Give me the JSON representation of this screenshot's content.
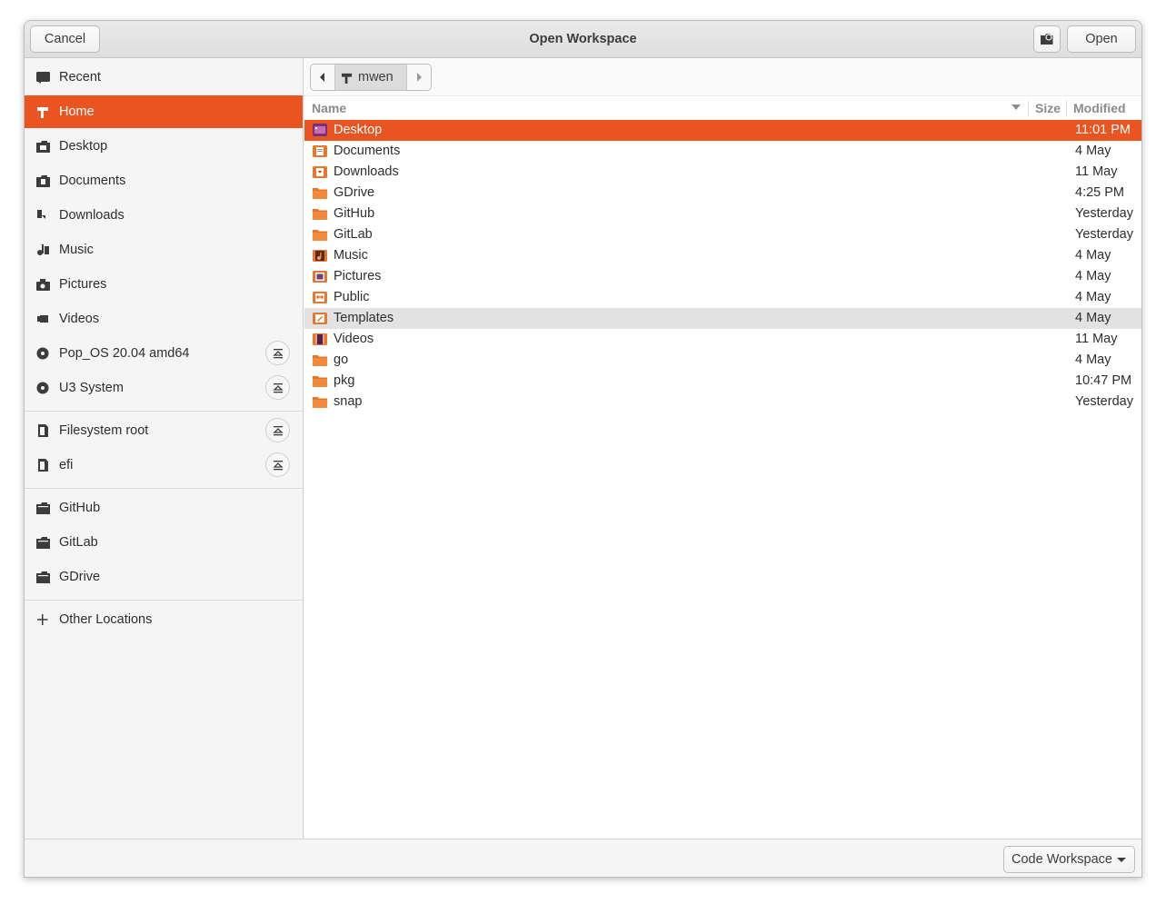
{
  "dialog": {
    "title": "Open Workspace",
    "cancel_label": "Cancel",
    "open_label": "Open",
    "new_folder_icon": "folder-new-icon"
  },
  "sidebar": {
    "items": [
      {
        "label": "Recent",
        "icon": "recent-icon"
      },
      {
        "label": "Home",
        "icon": "home-icon",
        "active": true
      },
      {
        "label": "Desktop",
        "icon": "desktop-folder-icon"
      },
      {
        "label": "Documents",
        "icon": "documents-folder-icon"
      },
      {
        "label": "Downloads",
        "icon": "downloads-folder-icon"
      },
      {
        "label": "Music",
        "icon": "music-folder-icon"
      },
      {
        "label": "Pictures",
        "icon": "pictures-folder-icon"
      },
      {
        "label": "Videos",
        "icon": "videos-folder-icon"
      },
      {
        "label": "Pop_OS 20.04 amd64",
        "icon": "optical-disc-icon",
        "eject": true
      },
      {
        "label": "U3 System",
        "icon": "optical-disc-icon",
        "eject": true
      },
      {
        "label": "Filesystem root",
        "icon": "drive-icon",
        "eject": true
      },
      {
        "label": "efi",
        "icon": "drive-icon",
        "eject": true
      },
      {
        "label": "GitHub",
        "icon": "bookmark-folder-icon"
      },
      {
        "label": "GitLab",
        "icon": "bookmark-folder-icon"
      },
      {
        "label": "GDrive",
        "icon": "bookmark-folder-icon"
      },
      {
        "label": "Other Locations",
        "icon": "plus-icon"
      }
    ]
  },
  "pathbar": {
    "current": "mwen",
    "back_icon": "chevron-left-icon",
    "forward_icon": "chevron-right-icon"
  },
  "filelist": {
    "columns": {
      "name": "Name",
      "size": "Size",
      "modified": "Modified"
    },
    "rows": [
      {
        "name": "Desktop",
        "modified": "11:01 PM",
        "selected": true,
        "icon": "desktop-folder-icon"
      },
      {
        "name": "Documents",
        "modified": "4 May",
        "icon": "documents-folder-icon"
      },
      {
        "name": "Downloads",
        "modified": "11 May",
        "icon": "downloads-folder-icon"
      },
      {
        "name": "GDrive",
        "modified": " 4:25 PM",
        "icon": "folder-icon"
      },
      {
        "name": "GitHub",
        "modified": "Yesterday",
        "icon": "folder-icon"
      },
      {
        "name": "GitLab",
        "modified": "Yesterday",
        "icon": "folder-icon"
      },
      {
        "name": "Music",
        "modified": "4 May",
        "icon": "music-folder-icon"
      },
      {
        "name": "Pictures",
        "modified": "4 May",
        "icon": "pictures-folder-icon"
      },
      {
        "name": "Public",
        "modified": "4 May",
        "icon": "public-folder-icon"
      },
      {
        "name": "Templates",
        "modified": "4 May",
        "hover": true,
        "icon": "templates-folder-icon"
      },
      {
        "name": "Videos",
        "modified": "11 May",
        "icon": "videos-folder-icon"
      },
      {
        "name": "go",
        "modified": "4 May",
        "icon": "folder-icon"
      },
      {
        "name": "pkg",
        "modified": "10:47 PM",
        "icon": "folder-icon"
      },
      {
        "name": "snap",
        "modified": "Yesterday",
        "icon": "folder-icon"
      }
    ]
  },
  "footer": {
    "filter_label": "Code Workspace"
  },
  "colors": {
    "accent": "#e95420",
    "folder": "#e8772e"
  }
}
